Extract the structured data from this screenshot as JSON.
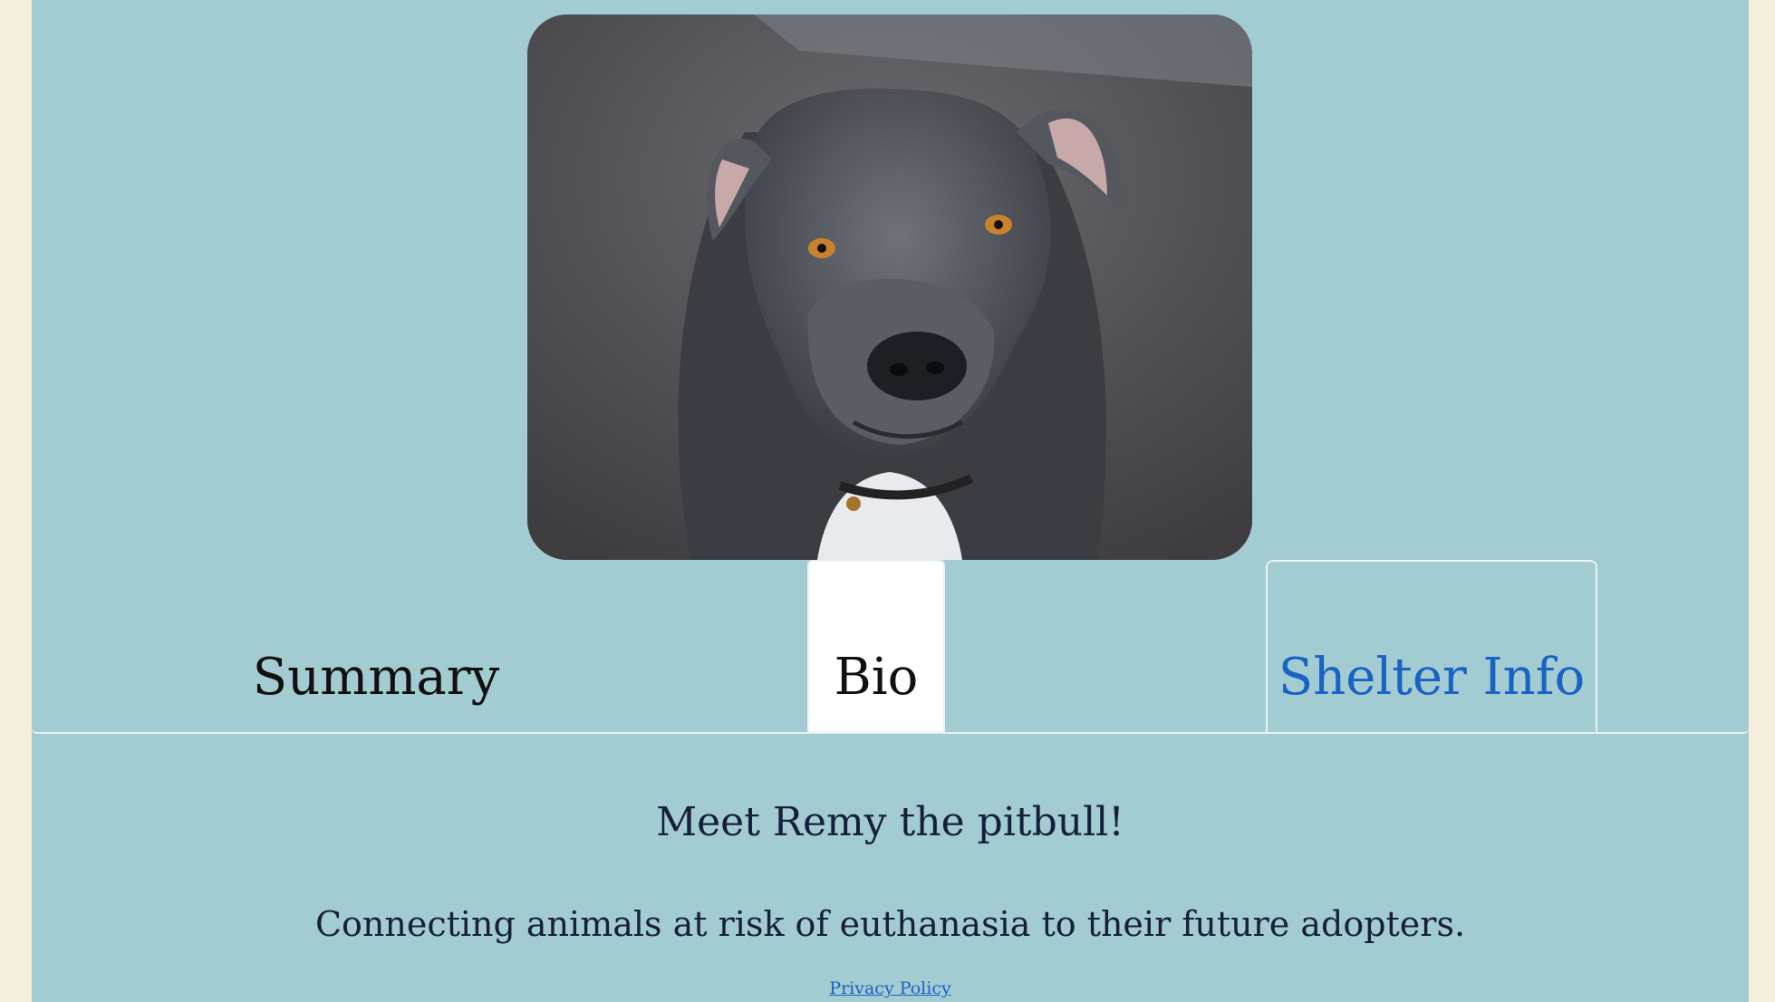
{
  "image": {
    "alt": "Remy the pitbull"
  },
  "tabs": [
    {
      "label": "Summary",
      "state": "inactive"
    },
    {
      "label": "Bio",
      "state": "active"
    },
    {
      "label": "Shelter Info",
      "state": "link"
    }
  ],
  "content": {
    "headline": "Meet Remy the pitbull!",
    "tagline": "Connecting animals at risk of euthanasia to their future adopters."
  },
  "footer": {
    "privacy_label": "Privacy Policy"
  },
  "colors": {
    "page_bg": "#f5f0de",
    "panel_bg": "#a3cbd2",
    "link": "#1a62c4",
    "text": "#15203a"
  }
}
